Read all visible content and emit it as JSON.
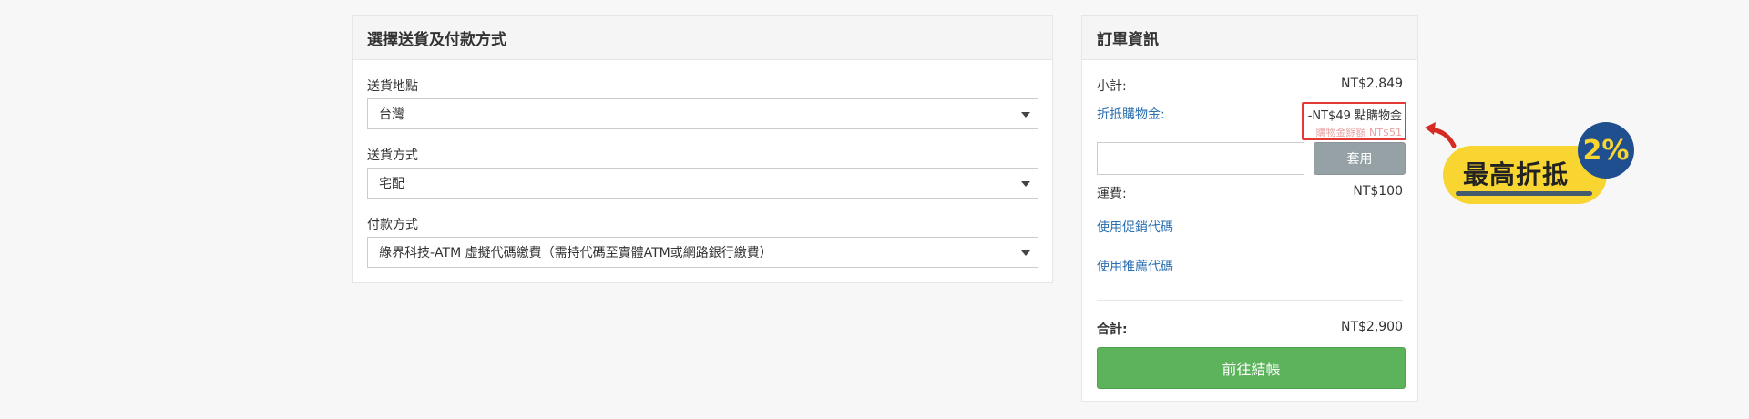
{
  "shipping": {
    "title": "選擇送貨及付款方式",
    "destination_label": "送貨地點",
    "destination_value": "台灣",
    "method_label": "送貨方式",
    "method_value": "宅配",
    "payment_label": "付款方式",
    "payment_value": "綠界科技-ATM 虛擬代碼繳費（需持代碼至實體ATM或網路銀行繳費）"
  },
  "order": {
    "title": "訂單資訊",
    "subtotal_label": "小計:",
    "subtotal_value": "NT$2,849",
    "credit_label": "折抵購物金:",
    "credit_value": "-NT$49 點購物金",
    "credit_balance": "購物金餘額 NT$51",
    "coupon_placeholder": "",
    "apply_label": "套用",
    "shipping_fee_label": "運費:",
    "shipping_fee_value": "NT$100",
    "promo_code_link": "使用促銷代碼",
    "referral_code_link": "使用推薦代碼",
    "total_label": "合計:",
    "total_value": "NT$2,900",
    "checkout_label": "前往結帳"
  },
  "promo": {
    "text": "最高折抵",
    "badge": "2%"
  },
  "colors": {
    "accent_green": "#5cb35c",
    "link_blue": "#2a6fb0",
    "highlight_red": "#e53935",
    "promo_yellow": "#f8d531",
    "promo_navy": "#1f4f8f"
  }
}
